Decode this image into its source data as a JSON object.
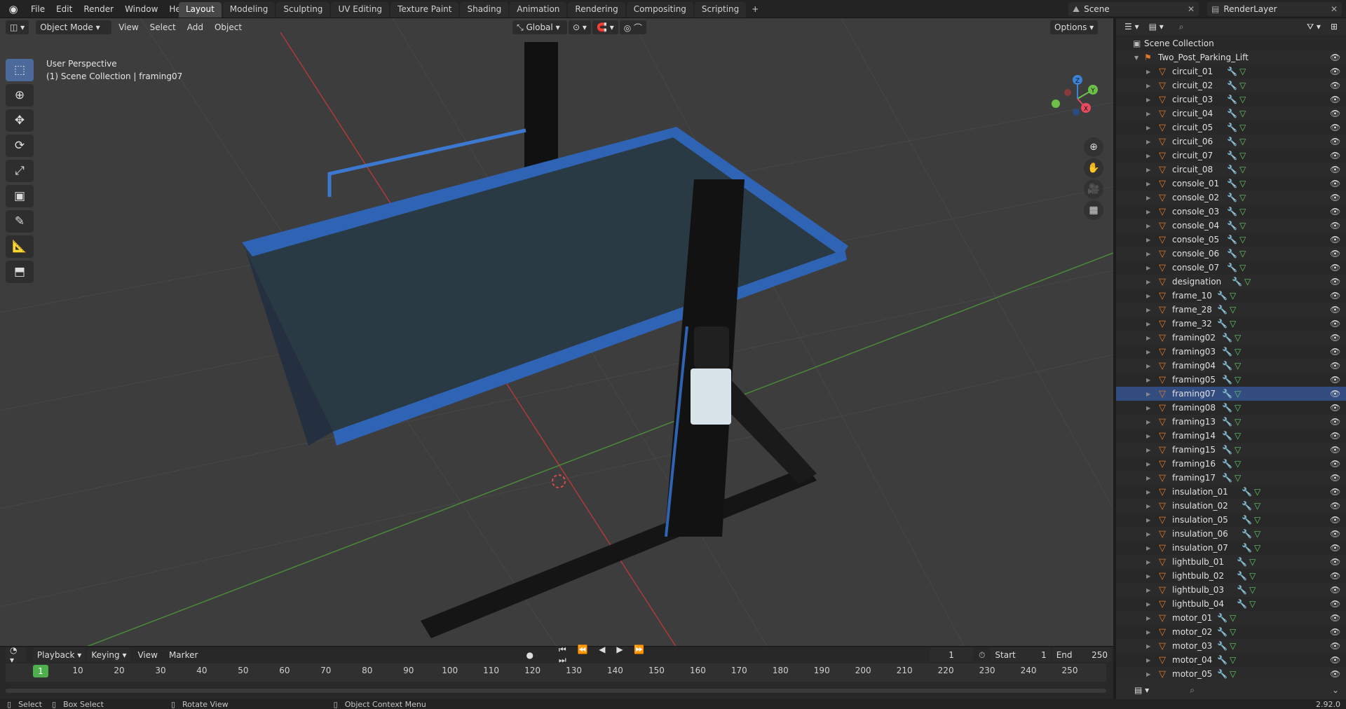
{
  "topbar": {
    "menus": [
      "File",
      "Edit",
      "Render",
      "Window",
      "Help"
    ],
    "tabs": [
      "Layout",
      "Modeling",
      "Sculpting",
      "UV Editing",
      "Texture Paint",
      "Shading",
      "Animation",
      "Rendering",
      "Compositing",
      "Scripting"
    ],
    "active_tab": "Layout",
    "add_tab": "+",
    "scene_name": "Scene",
    "view_layer": "RenderLayer"
  },
  "viewport_header": {
    "mode": "Object Mode",
    "menus": [
      "View",
      "Select",
      "Add",
      "Object"
    ],
    "orientation": "Global",
    "options": "Options"
  },
  "viewport": {
    "perspective": "User Perspective",
    "context": "(1) Scene Collection | framing07"
  },
  "gizmo": {
    "x": "X",
    "y": "Y",
    "z": "Z",
    "x_color": "#e84a5f",
    "y_color": "#6cc04a",
    "z_color": "#3c83d7"
  },
  "timeline": {
    "menus": [
      "Playback",
      "Keying",
      "View",
      "Marker"
    ],
    "current_frame": "1",
    "start_label": "Start",
    "start": "1",
    "end_label": "End",
    "end": "250",
    "ticks": [
      "1",
      "10",
      "20",
      "30",
      "40",
      "50",
      "60",
      "70",
      "80",
      "90",
      "100",
      "110",
      "120",
      "130",
      "140",
      "150",
      "160",
      "170",
      "180",
      "190",
      "200",
      "210",
      "220",
      "230",
      "240",
      "250"
    ]
  },
  "statusbar": {
    "select": "Select",
    "box_select": "Box Select",
    "rotate": "Rotate View",
    "context_menu": "Object Context Menu",
    "version": "2.92.0"
  },
  "outliner": {
    "root": "Scene Collection",
    "collection": "Two_Post_Parking_Lift",
    "selected": "framing07",
    "items": [
      "circuit_01",
      "circuit_02",
      "circuit_03",
      "circuit_04",
      "circuit_05",
      "circuit_06",
      "circuit_07",
      "circuit_08",
      "console_01",
      "console_02",
      "console_03",
      "console_04",
      "console_05",
      "console_06",
      "console_07",
      "designation",
      "frame_10",
      "frame_28",
      "frame_32",
      "framing02",
      "framing03",
      "framing04",
      "framing05",
      "framing07",
      "framing08",
      "framing13",
      "framing14",
      "framing15",
      "framing16",
      "framing17",
      "insulation_01",
      "insulation_02",
      "insulation_05",
      "insulation_06",
      "insulation_07",
      "lightbulb_01",
      "lightbulb_02",
      "lightbulb_03",
      "lightbulb_04",
      "motor_01",
      "motor_02",
      "motor_03",
      "motor_04",
      "motor_05"
    ]
  },
  "colors": {
    "accent": "#4b6a9b",
    "selected_row": "#334d80",
    "mesh_icon": "#e07a2a",
    "lift_blue": "#2f63b4"
  }
}
